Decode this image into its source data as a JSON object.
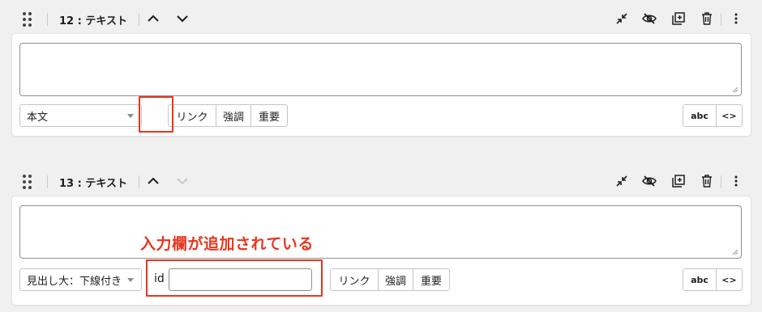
{
  "blocks": [
    {
      "title": "12 : テキスト",
      "format_value": "本文",
      "inline_buttons": [
        "リンク",
        "強調",
        "重要"
      ],
      "right_buttons": [
        "abc",
        "<>"
      ],
      "toolbar_icons": [
        "drag-handle-icon",
        "chevron-up-icon",
        "chevron-down-icon",
        "collapse-icon",
        "eye-off-icon",
        "add-block-icon",
        "trash-icon",
        "more-vertical-icon"
      ]
    },
    {
      "title": "13 : テキスト",
      "format_value": "見出し大：下線付き",
      "id_label": "id",
      "id_value": "",
      "inline_buttons": [
        "リンク",
        "強調",
        "重要"
      ],
      "right_buttons": [
        "abc",
        "<>"
      ],
      "toolbar_icons": [
        "drag-handle-icon",
        "chevron-up-icon",
        "chevron-down-icon-disabled",
        "collapse-icon",
        "eye-off-icon",
        "add-block-icon",
        "trash-icon",
        "more-vertical-icon"
      ]
    }
  ],
  "annotation": "入力欄が追加されている",
  "colors": {
    "highlight": "#e8361f",
    "background": "#f0f0f1"
  }
}
